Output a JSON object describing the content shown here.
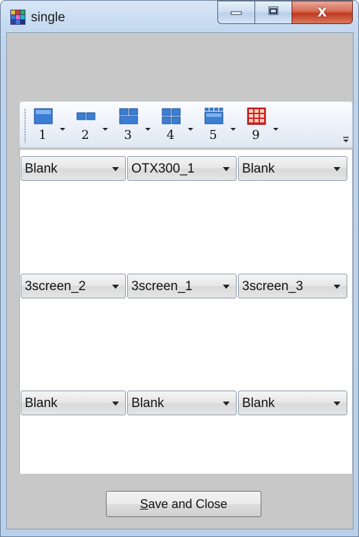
{
  "window": {
    "title": "single",
    "icon": "app-grid-icon",
    "controls": {
      "minimize_icon": "minimize-icon",
      "maximize_icon": "maximize-icon",
      "close_icon": "close-icon",
      "close_glyph": "X"
    }
  },
  "toolbar": {
    "buttons": [
      {
        "label": "1",
        "icon": "layout-1-icon"
      },
      {
        "label": "2",
        "icon": "layout-2-icon"
      },
      {
        "label": "3",
        "icon": "layout-3-icon"
      },
      {
        "label": "4",
        "icon": "layout-4-icon"
      },
      {
        "label": "5",
        "icon": "layout-5-icon"
      },
      {
        "label": "9",
        "icon": "layout-9-icon"
      }
    ],
    "accent_color": "#1f6fd1",
    "layout9_color": "#d42020"
  },
  "grid": {
    "rows": [
      [
        "Blank",
        "OTX300_1",
        "Blank"
      ],
      [
        "3screen_2",
        "3screen_1",
        "3screen_3"
      ],
      [
        "Blank",
        "Blank",
        "Blank"
      ]
    ]
  },
  "footer": {
    "save_button_mnemonic": "S",
    "save_button_rest": "ave and Close"
  }
}
